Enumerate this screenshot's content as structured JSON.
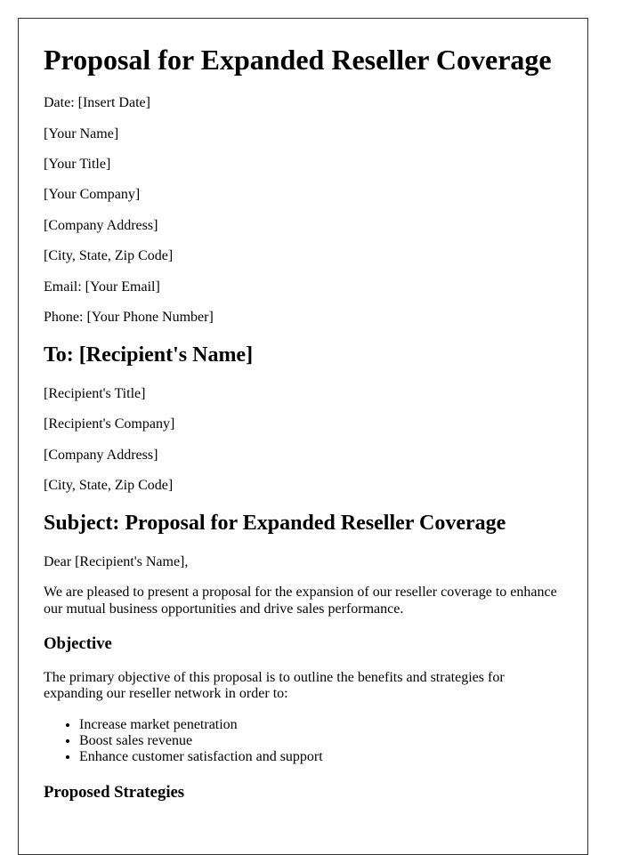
{
  "document": {
    "title": "Proposal for Expanded Reseller Coverage",
    "sender": {
      "date": "Date: [Insert Date]",
      "name": "[Your Name]",
      "title": "[Your Title]",
      "company": "[Your Company]",
      "address": "[Company Address]",
      "city_state_zip": "[City, State, Zip Code]",
      "email": "Email: [Your Email]",
      "phone": "Phone: [Your Phone Number]"
    },
    "recipient": {
      "heading": "To: [Recipient's Name]",
      "title": "[Recipient's Title]",
      "company": "[Recipient's Company]",
      "address": "[Company Address]",
      "city_state_zip": "[City, State, Zip Code]"
    },
    "subject": "Subject: Proposal for Expanded Reseller Coverage",
    "salutation": "Dear [Recipient's Name],",
    "intro": "We are pleased to present a proposal for the expansion of our reseller coverage to enhance our mutual business opportunities and drive sales performance.",
    "sections": [
      {
        "heading": "Objective",
        "body": "The primary objective of this proposal is to outline the benefits and strategies for expanding our reseller network in order to:",
        "bullets": [
          "Increase market penetration",
          "Boost sales revenue",
          "Enhance customer satisfaction and support"
        ]
      },
      {
        "heading": "Proposed Strategies"
      }
    ]
  }
}
